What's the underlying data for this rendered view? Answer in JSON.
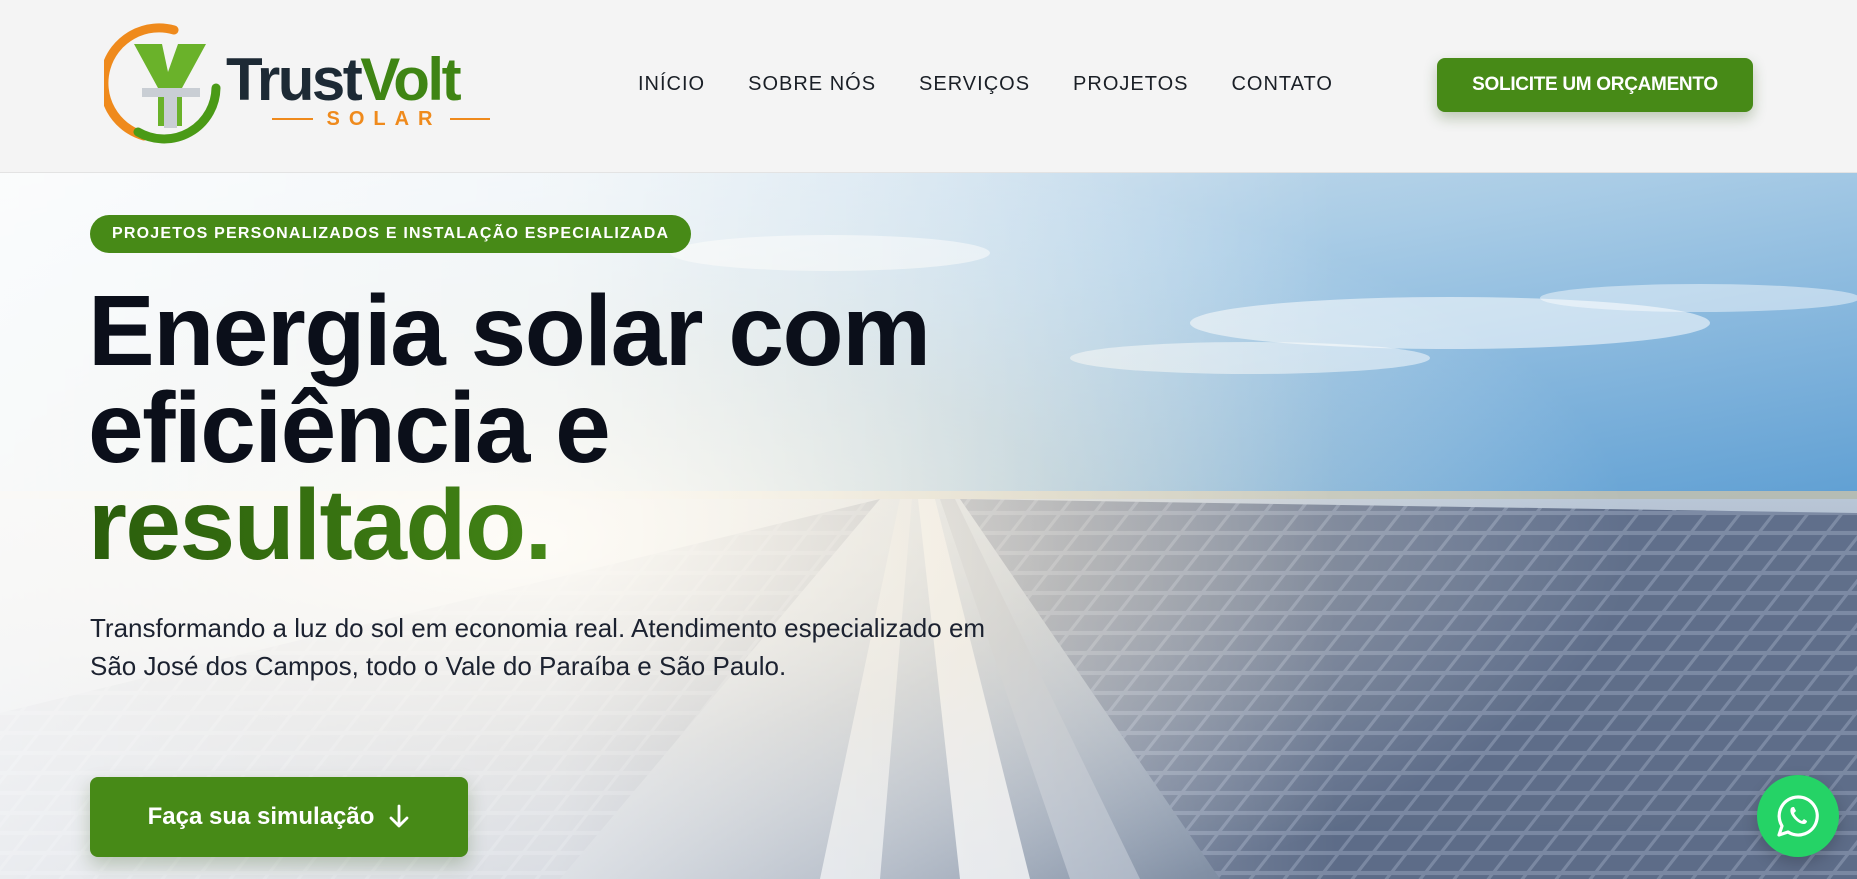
{
  "brand": {
    "name_part1": "Trust",
    "name_part2": "Volt",
    "tagline": "SOLAR",
    "colors": {
      "green": "#478a17",
      "orange": "#ef8a1c",
      "navy": "#1d2a35"
    }
  },
  "nav": {
    "items": [
      "INÍCIO",
      "SOBRE NÓS",
      "SERVIÇOS",
      "PROJETOS",
      "CONTATO"
    ]
  },
  "header": {
    "cta_label": "SOLICITE UM ORÇAMENTO"
  },
  "hero": {
    "tag": "PROJETOS PERSONALIZADOS E INSTALAÇÃO ESPECIALIZADA",
    "headline_line1": "Energia solar com",
    "headline_line2": "eficiência e",
    "headline_accent": "resultado.",
    "subtitle": "Transformando a luz do sol em economia real. Atendimento especializado em São José dos Campos, todo o Vale do Paraíba e São Paulo.",
    "cta_label": "Faça sua simulação",
    "cta_icon": "arrow-down-icon"
  },
  "floating": {
    "whatsapp_icon": "whatsapp-icon"
  }
}
